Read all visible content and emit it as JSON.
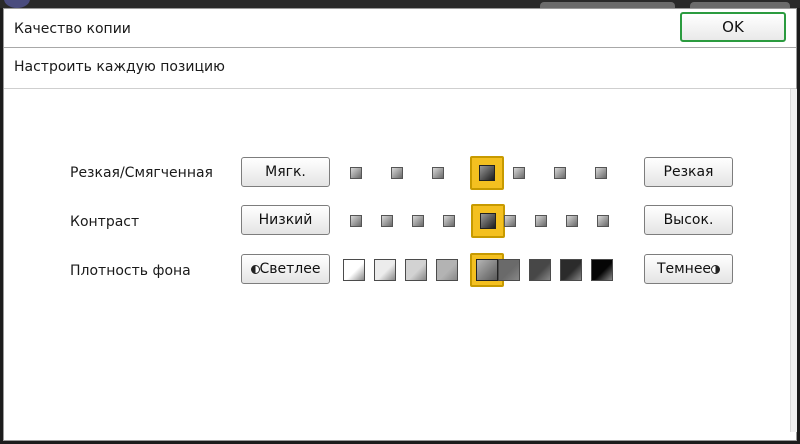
{
  "window": {
    "title": "Качество копии",
    "ok_label": "OK",
    "subtitle": "Настроить каждую позицию"
  },
  "rows": [
    {
      "label": "Резкая/Смягченная",
      "left_button": "Мягк.",
      "right_button": "Резкая",
      "levels": 7,
      "selected": 4
    },
    {
      "label": "Контраст",
      "left_button": "Низкий",
      "right_button": "Высок.",
      "levels": 9,
      "selected": 5
    },
    {
      "label": "Плотность фона",
      "left_button": "Светлее",
      "right_button": "Темнее",
      "levels": 9,
      "selected": 5,
      "level_colors": [
        "#ffffff",
        "#ececec",
        "#d2d2d2",
        "#b3b3b3",
        "#9a9a9a",
        "#6a6a6a",
        "#474747",
        "#2b2b2b",
        "#050505"
      ]
    }
  ],
  "colors": {
    "ok_border": "#2b9b3f",
    "selection": "#f4c020"
  }
}
